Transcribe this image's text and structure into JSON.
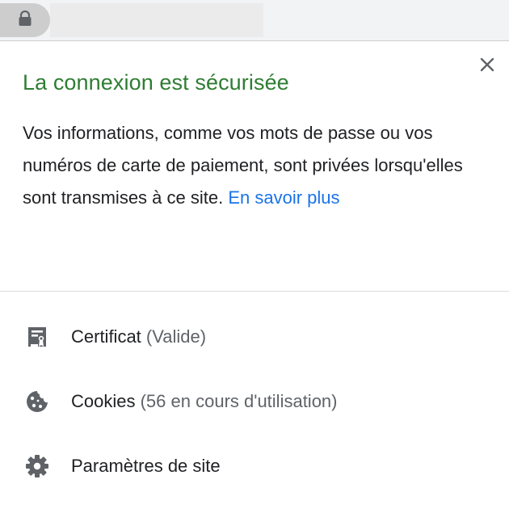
{
  "toolbar": {
    "lock_icon": "lock-icon",
    "url_text": ""
  },
  "popup": {
    "close_icon": "close-icon",
    "title": "La connexion est sécurisée",
    "description": "Vos informations, comme vos mots de passe ou vos numéros de carte de paiement, sont privées lorsqu'elles sont transmises à ce site.",
    "learn_more": "En savoir plus",
    "items": [
      {
        "icon": "certificate-icon",
        "label": "Certificat",
        "sub": "(Valide)"
      },
      {
        "icon": "cookie-icon",
        "label": "Cookies",
        "sub": "(56 en cours d'utilisation)"
      },
      {
        "icon": "gear-icon",
        "label": "Paramètres de site",
        "sub": ""
      }
    ]
  },
  "colors": {
    "title_green": "#2e7d32",
    "link_blue": "#1a73e8",
    "text": "#202124",
    "secondary_text": "#5f6368",
    "icon_gray": "#5f6368"
  }
}
